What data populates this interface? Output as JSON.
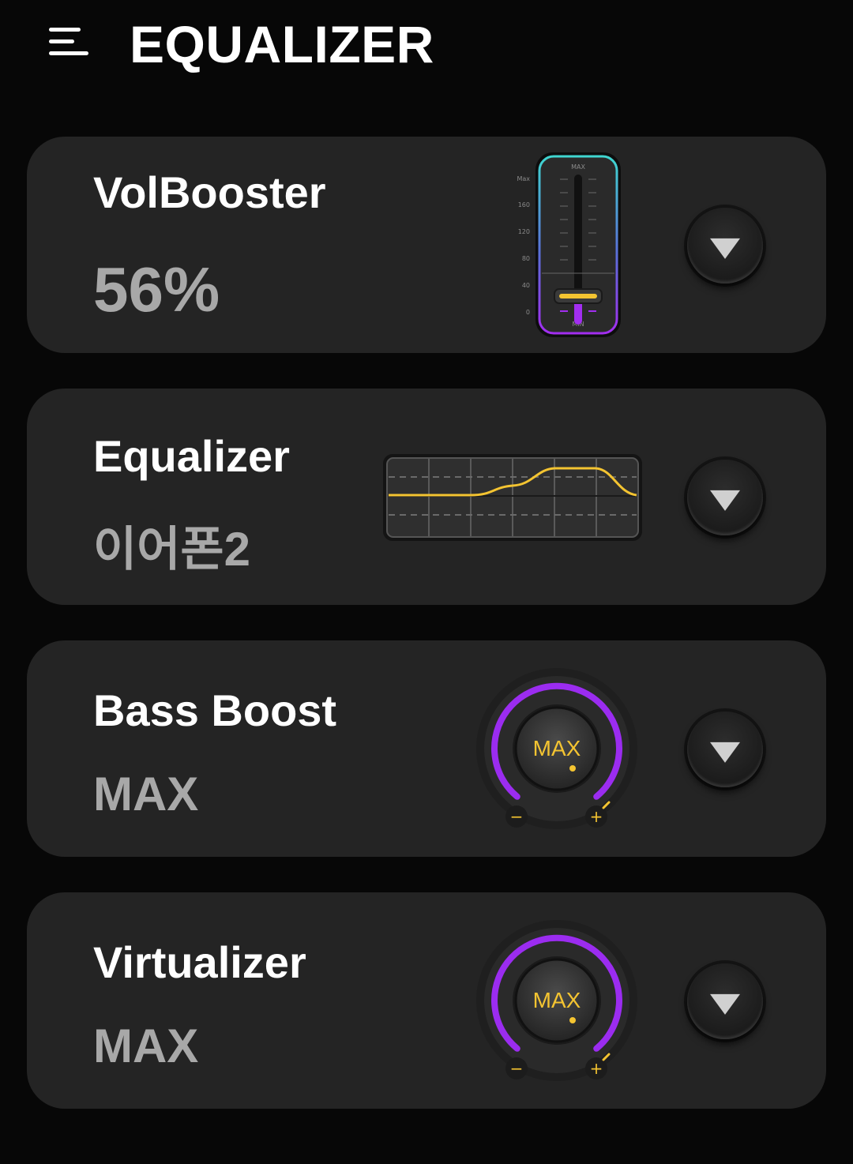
{
  "header": {
    "title": "EQUALIZER",
    "menu_icon": "hamburger-menu-icon"
  },
  "cards": [
    {
      "title": "VolBooster",
      "value": "56%",
      "widget": "volume-slider",
      "level_percent": 56,
      "expand_icon": "triangle-down-icon"
    },
    {
      "title": "Equalizer",
      "value": "이어폰2",
      "widget": "eq-curve-preview",
      "expand_icon": "triangle-down-icon"
    },
    {
      "title": "Bass Boost",
      "value": "MAX",
      "widget": "knob",
      "knob_label": "MAX",
      "expand_icon": "triangle-down-icon"
    },
    {
      "title": "Virtualizer",
      "value": "MAX",
      "widget": "knob",
      "knob_label": "MAX",
      "expand_icon": "triangle-down-icon"
    }
  ],
  "slider": {
    "top_label": "MAX",
    "bottom_label": "MIN",
    "scale": [
      "Max",
      "160",
      "120",
      "80",
      "40",
      "0"
    ]
  },
  "knob_signs": {
    "minus": "−",
    "plus": "+"
  },
  "colors": {
    "background": "#070707",
    "card": "#242424",
    "accent_purple": "#9b2cf0",
    "accent_yellow": "#f4c431",
    "accent_teal": "#3fd6d0",
    "value_text": "#a8a8a8"
  }
}
